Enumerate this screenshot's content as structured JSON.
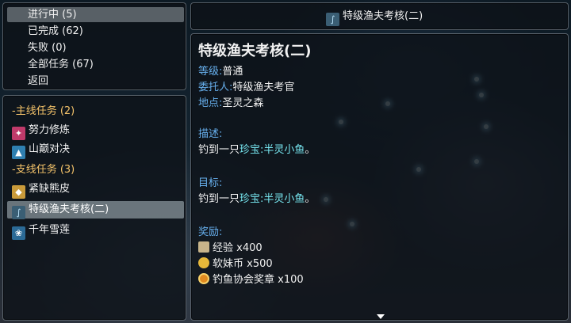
{
  "filters": [
    {
      "label": "进行中 (5)"
    },
    {
      "label": "已完成 (62)"
    },
    {
      "label": "失败 (0)"
    },
    {
      "label": "全部任务 (67)"
    },
    {
      "label": "返回"
    }
  ],
  "quest_list": {
    "main_header": "-主线任务 (2)",
    "main_items": [
      "努力修炼",
      "山巅对决"
    ],
    "side_header": "-支线任务 (3)",
    "side_items": [
      "紧缺熊皮",
      "特级渔夫考核(二)",
      "千年雪莲"
    ]
  },
  "detail": {
    "window_title": "特级渔夫考核(二)",
    "heading": "特级渔夫考核(二)",
    "level_label": "等级:",
    "level_value": "普通",
    "client_label": "委托人:",
    "client_value": "特级渔夫考官",
    "location_label": "地点:",
    "location_value": "圣灵之森",
    "desc_label": "描述:",
    "desc_prefix": "钓到一只",
    "desc_highlight": "珍宝:半灵小鱼",
    "desc_suffix": "。",
    "goal_label": "目标:",
    "goal_prefix": "钓到一只",
    "goal_highlight": "珍宝:半灵小鱼",
    "goal_suffix": "。",
    "reward_label": "奖励:",
    "rewards": [
      {
        "name": "经验",
        "amount": "x400",
        "icon": "exp-scroll-icon"
      },
      {
        "name": "软妹币",
        "amount": "x500",
        "icon": "coin-icon"
      },
      {
        "name": "钓鱼协会奖章",
        "amount": "x100",
        "icon": "medal-icon"
      }
    ]
  },
  "colors": {
    "label_blue": "#67b0ee",
    "highlight_cyan": "#78e8f2",
    "selection": "#b4c3c8"
  }
}
